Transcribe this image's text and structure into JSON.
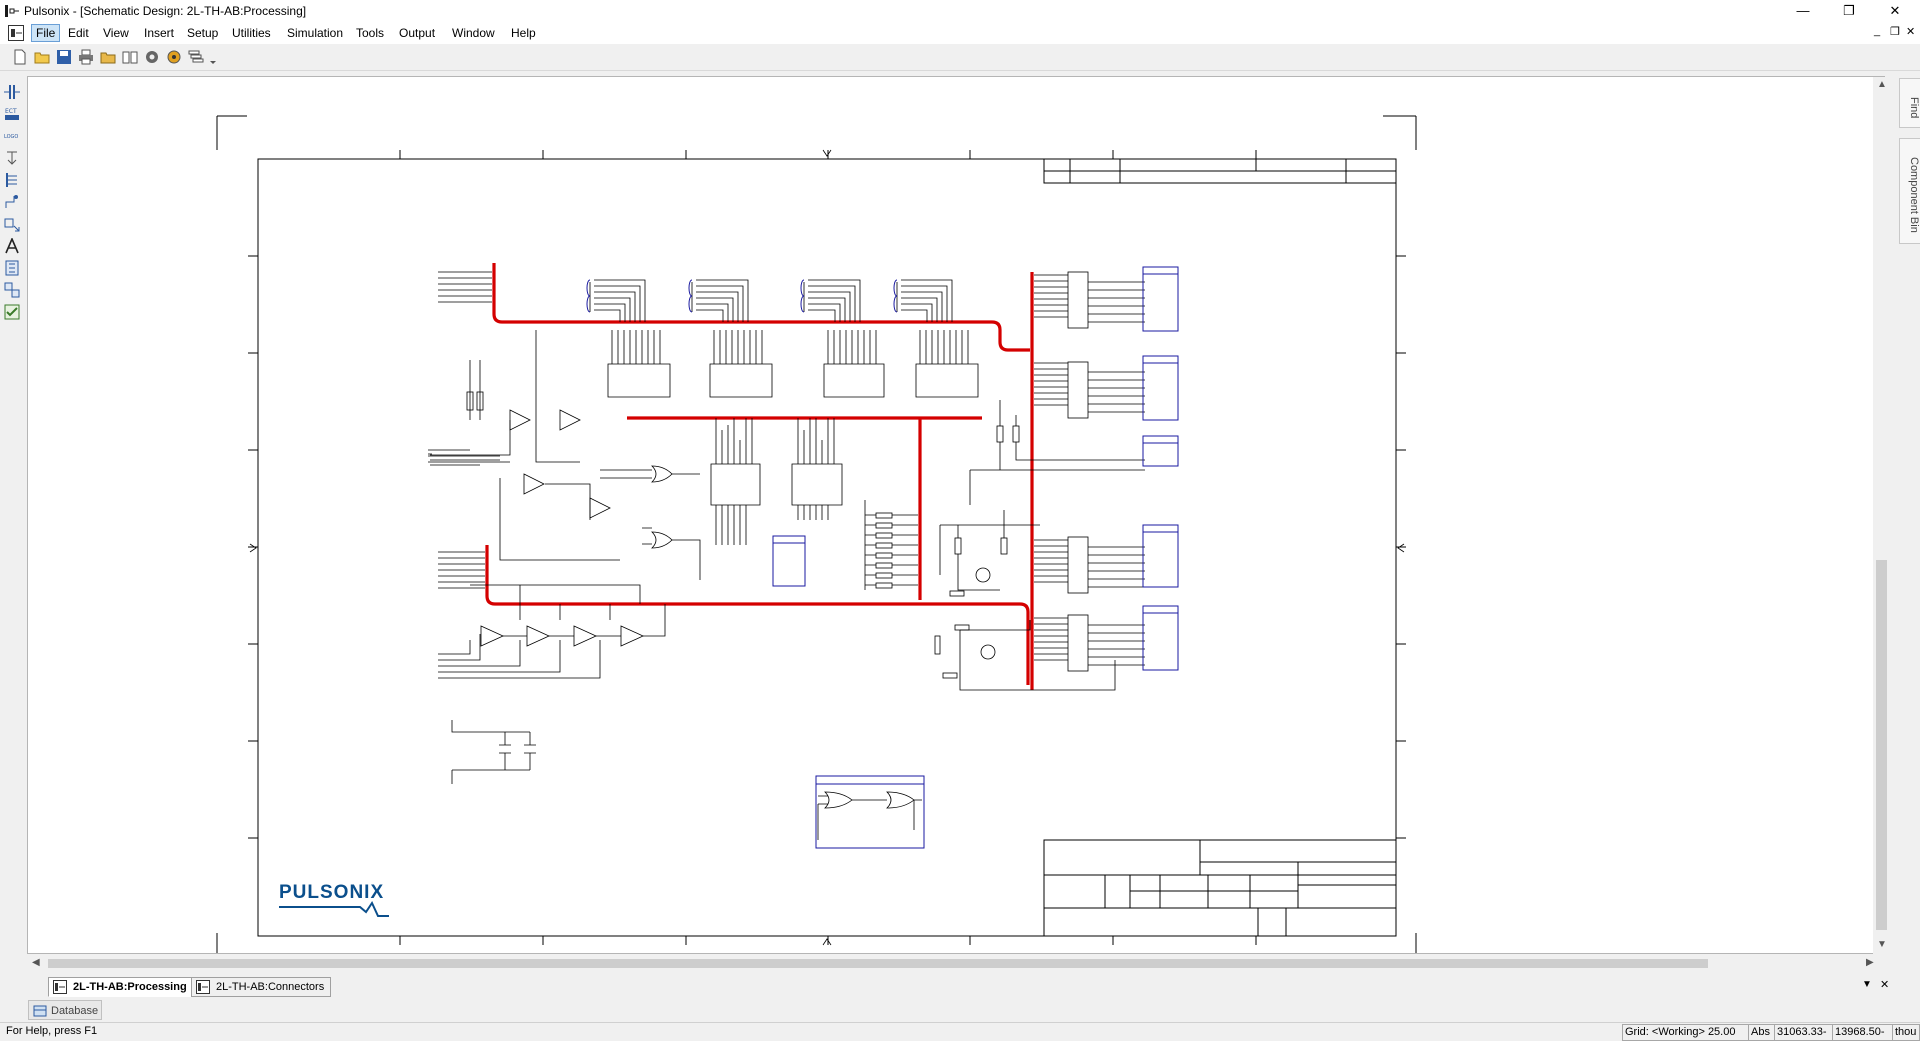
{
  "window": {
    "title": "Pulsonix - [Schematic Design: 2L-TH-AB:Processing]",
    "minimize_glyph": "—",
    "restore_glyph": "❐",
    "close_glyph": "✕"
  },
  "menu": {
    "items": [
      "File",
      "Edit",
      "View",
      "Insert",
      "Setup",
      "Utilities",
      "Simulation",
      "Tools",
      "Output",
      "Window",
      "Help"
    ],
    "active": "File",
    "mdi_min": "_",
    "mdi_restore": "❐",
    "mdi_close": "✕"
  },
  "toolbar": {
    "icons": [
      "new-file-icon",
      "open-folder-icon",
      "save-icon",
      "print-icon",
      "open-library-icon",
      "book-icon",
      "library-manager-icon",
      "settings-icon",
      "component-icon",
      "filter-icon"
    ]
  },
  "left_toolbar": {
    "icons": [
      "add-component-icon",
      "ecn-icon",
      "logo-icon",
      "connection-icon",
      "bus-icon",
      "terminal-icon",
      "move-icon",
      "text-icon",
      "block-icon",
      "symbol-icon",
      "check-icon"
    ],
    "labels": {
      "ecn": "ECT",
      "logo": "LOGO"
    }
  },
  "right_panel": {
    "tabs": [
      "Find",
      "Component Bin"
    ]
  },
  "schematic": {
    "logo_text": "PULSONIX",
    "wire_color": "#000000",
    "bus_color": "#d40000",
    "connector_color": "#1a1aa0",
    "logo_color": "#0b4f8c"
  },
  "doc_tabs": [
    {
      "label": "2L-TH-AB:Processing",
      "active": true
    },
    {
      "label": "2L-TH-AB:Connectors",
      "active": false
    }
  ],
  "doc_tab_controls": {
    "dropdown": "▼",
    "close": "✕"
  },
  "database_panel": {
    "label": "Database"
  },
  "status": {
    "help": "For Help, press F1",
    "grid": "Grid: <Working> 25.00",
    "mode": "Abs",
    "x": "31063.33-",
    "y": "13968.50-",
    "units": "thou"
  }
}
